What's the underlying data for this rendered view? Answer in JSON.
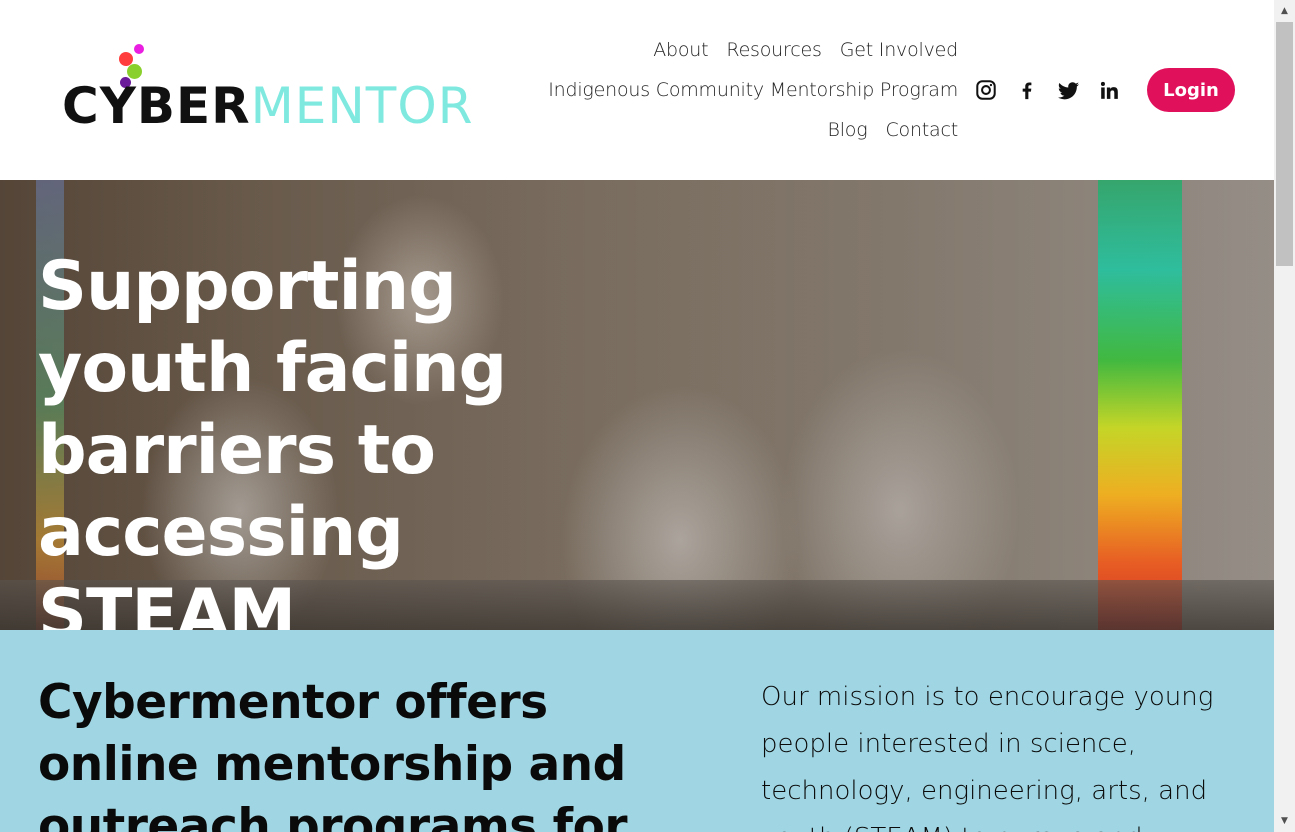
{
  "logo": {
    "text_dark": "CYBER",
    "text_light": "MENTOR",
    "dot_colors": [
      "#e91e63",
      "#ff3d3d",
      "#8ad02c",
      "#7b1fa2",
      "#ff1493"
    ]
  },
  "nav": {
    "row1": [
      "About",
      "Resources",
      "Get Involved"
    ],
    "row2": [
      "Indigenous Community Mentorship Program"
    ],
    "row3": [
      "Blog",
      "Contact"
    ]
  },
  "social": [
    "instagram-icon",
    "facebook-icon",
    "twitter-icon",
    "linkedin-icon"
  ],
  "login_label": "Login",
  "colors": {
    "accent": "#e0105b",
    "mission_bg": "#a0d6e3",
    "logo_light": "#7fe9e0"
  },
  "hero": {
    "title": "Supporting youth facing barriers to accessing STEAM education."
  },
  "mission": {
    "left": "Cybermentor offers online mentorship and outreach programs for",
    "right": "Our mission is to encourage young people interested in science, technology, engineering, arts, and youth (STEAM) to pursue and"
  }
}
